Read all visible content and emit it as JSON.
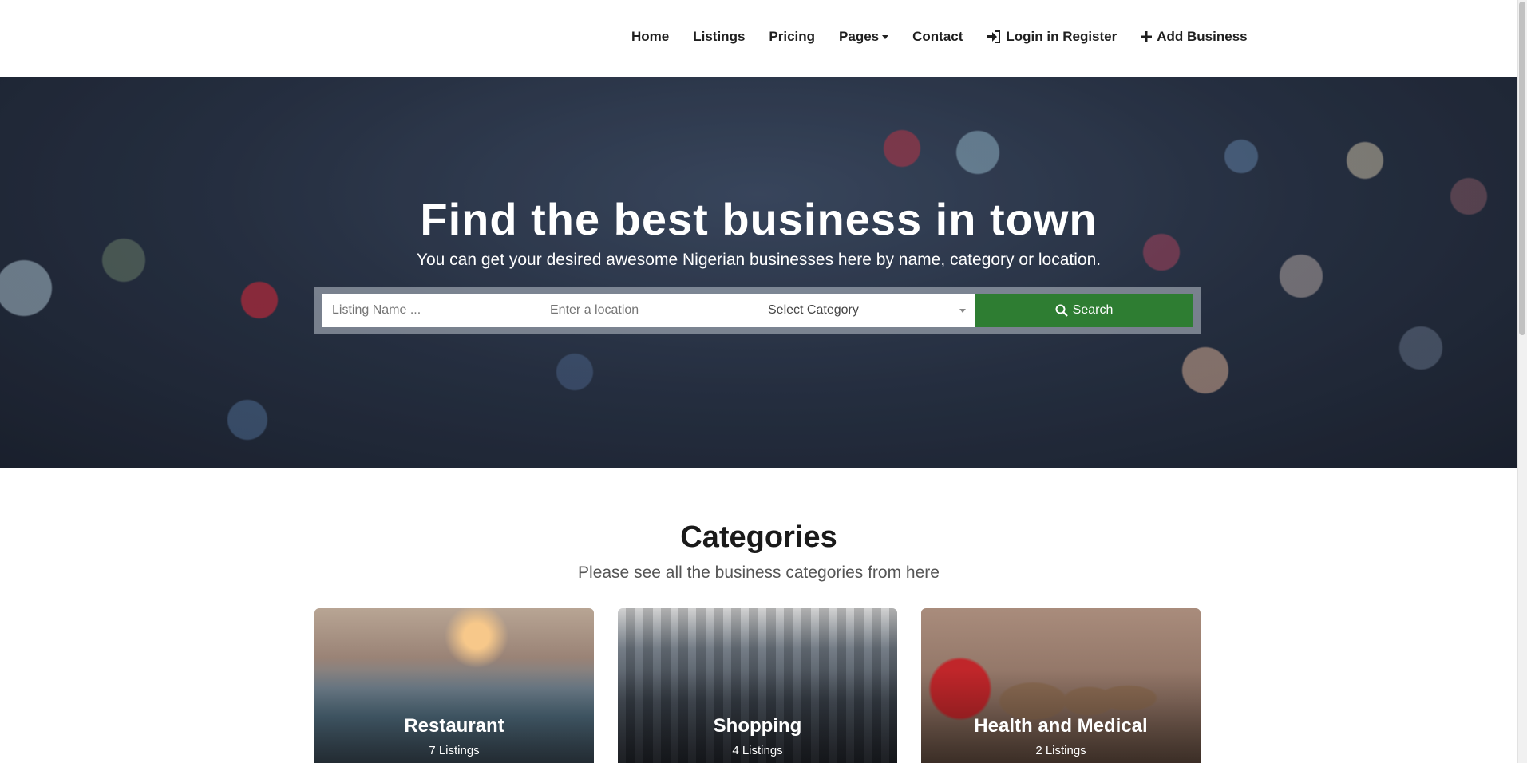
{
  "nav": {
    "items": [
      {
        "label": "Home"
      },
      {
        "label": "Listings"
      },
      {
        "label": "Pricing"
      },
      {
        "label": "Pages",
        "icon": "chevron-down-icon"
      },
      {
        "label": "Contact"
      },
      {
        "label": "Login in Register",
        "icon": "sign-in-icon"
      },
      {
        "label": "Add Business",
        "icon": "plus-icon"
      }
    ]
  },
  "hero": {
    "title": "Find the best business in town",
    "subtitle": "You can get your desired awesome Nigerian businesses here by name, category or location.",
    "search": {
      "name_placeholder": "Listing Name ...",
      "location_placeholder": "Enter a location",
      "category_selected": "Select Category",
      "button_label": "Search",
      "button_icon": "search-icon",
      "button_color": "#2e7d32"
    }
  },
  "categories": {
    "title": "Categories",
    "subtitle": "Please see all the business categories from here",
    "cards": [
      {
        "name": "Restaurant",
        "count": "7 Listings"
      },
      {
        "name": "Shopping",
        "count": "4 Listings"
      },
      {
        "name": "Health and Medical",
        "count": "2 Listings"
      }
    ]
  }
}
